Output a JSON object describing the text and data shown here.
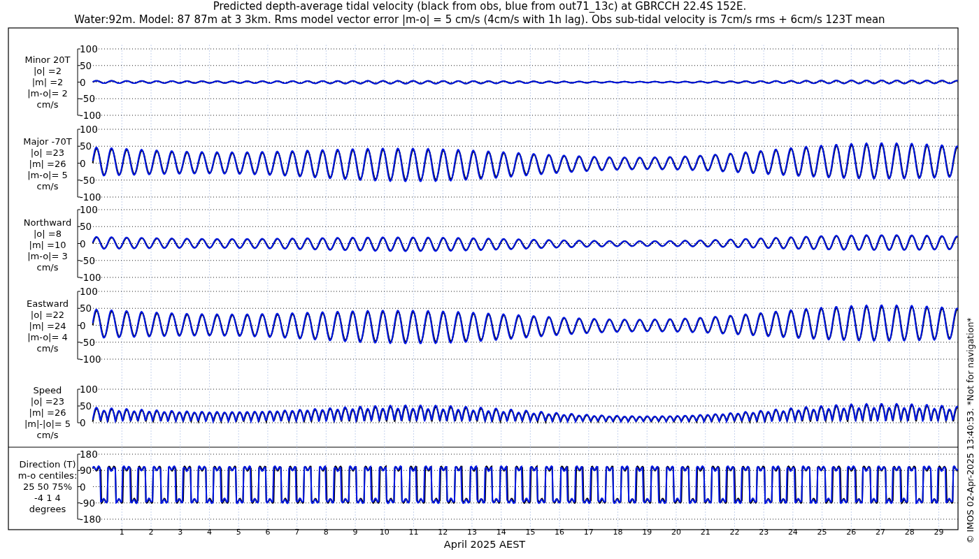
{
  "title_lines": [
    "Predicted depth-average tidal velocity (black from obs, blue from out71_13c) at GBRCCH 22.4S 152E.",
    "Water:92m. Model: 87 87m at 3 3km. Rms model vector error |m-o| = 5 cm/s (4cm/s with 1h lag). Obs sub-tidal velocity is 7cm/s rms + 6cm/s 123T mean"
  ],
  "panels": [
    {
      "kind": "minor",
      "label_lines": [
        "Minor 20T",
        "|o| =2",
        "|m| =2",
        "|m-o|= 2",
        "cm/s"
      ],
      "yticks": [
        "100",
        "50",
        "0",
        "-50",
        "-100"
      ]
    },
    {
      "kind": "major",
      "label_lines": [
        "Major -70T",
        "|o| =23",
        "|m| =26",
        "|m-o|= 5",
        "cm/s"
      ],
      "yticks": [
        "100",
        "50",
        "0",
        "-50",
        "-100"
      ]
    },
    {
      "kind": "northward",
      "label_lines": [
        "Northward",
        "|o| =8",
        "|m| =10",
        "|m-o|= 3",
        "cm/s"
      ],
      "yticks": [
        "100",
        "50",
        "0",
        "-50",
        "-100"
      ]
    },
    {
      "kind": "eastward",
      "label_lines": [
        "Eastward",
        "|o| =22",
        "|m| =24",
        "|m-o|= 4",
        "cm/s"
      ],
      "yticks": [
        "100",
        "50",
        "0",
        "-50",
        "-100"
      ]
    },
    {
      "kind": "speed",
      "label_lines": [
        "Speed",
        "|o| =23",
        "|m| =26",
        "|m|-|o|= 5",
        "cm/s"
      ],
      "yticks": [
        "100",
        "50",
        "0"
      ]
    },
    {
      "kind": "direction",
      "label_lines": [
        "Direction (T)",
        "m-o centiles:",
        "25  50  75%",
        "-4  1  4",
        "degrees"
      ],
      "yticks": [
        "180",
        "90",
        "0",
        "-90",
        "-180"
      ]
    }
  ],
  "x_ticks": [
    "1",
    "2",
    "3",
    "4",
    "5",
    "6",
    "7",
    "8",
    "9",
    "10",
    "11",
    "12",
    "13",
    "14",
    "15",
    "16",
    "17",
    "18",
    "19",
    "20",
    "21",
    "22",
    "23",
    "24",
    "25",
    "26",
    "27",
    "28",
    "29"
  ],
  "xlabel": "April 2025 AEST",
  "credit": "© IMOS 02-Apr-2025 13:40:53. *Not for navigation*"
}
